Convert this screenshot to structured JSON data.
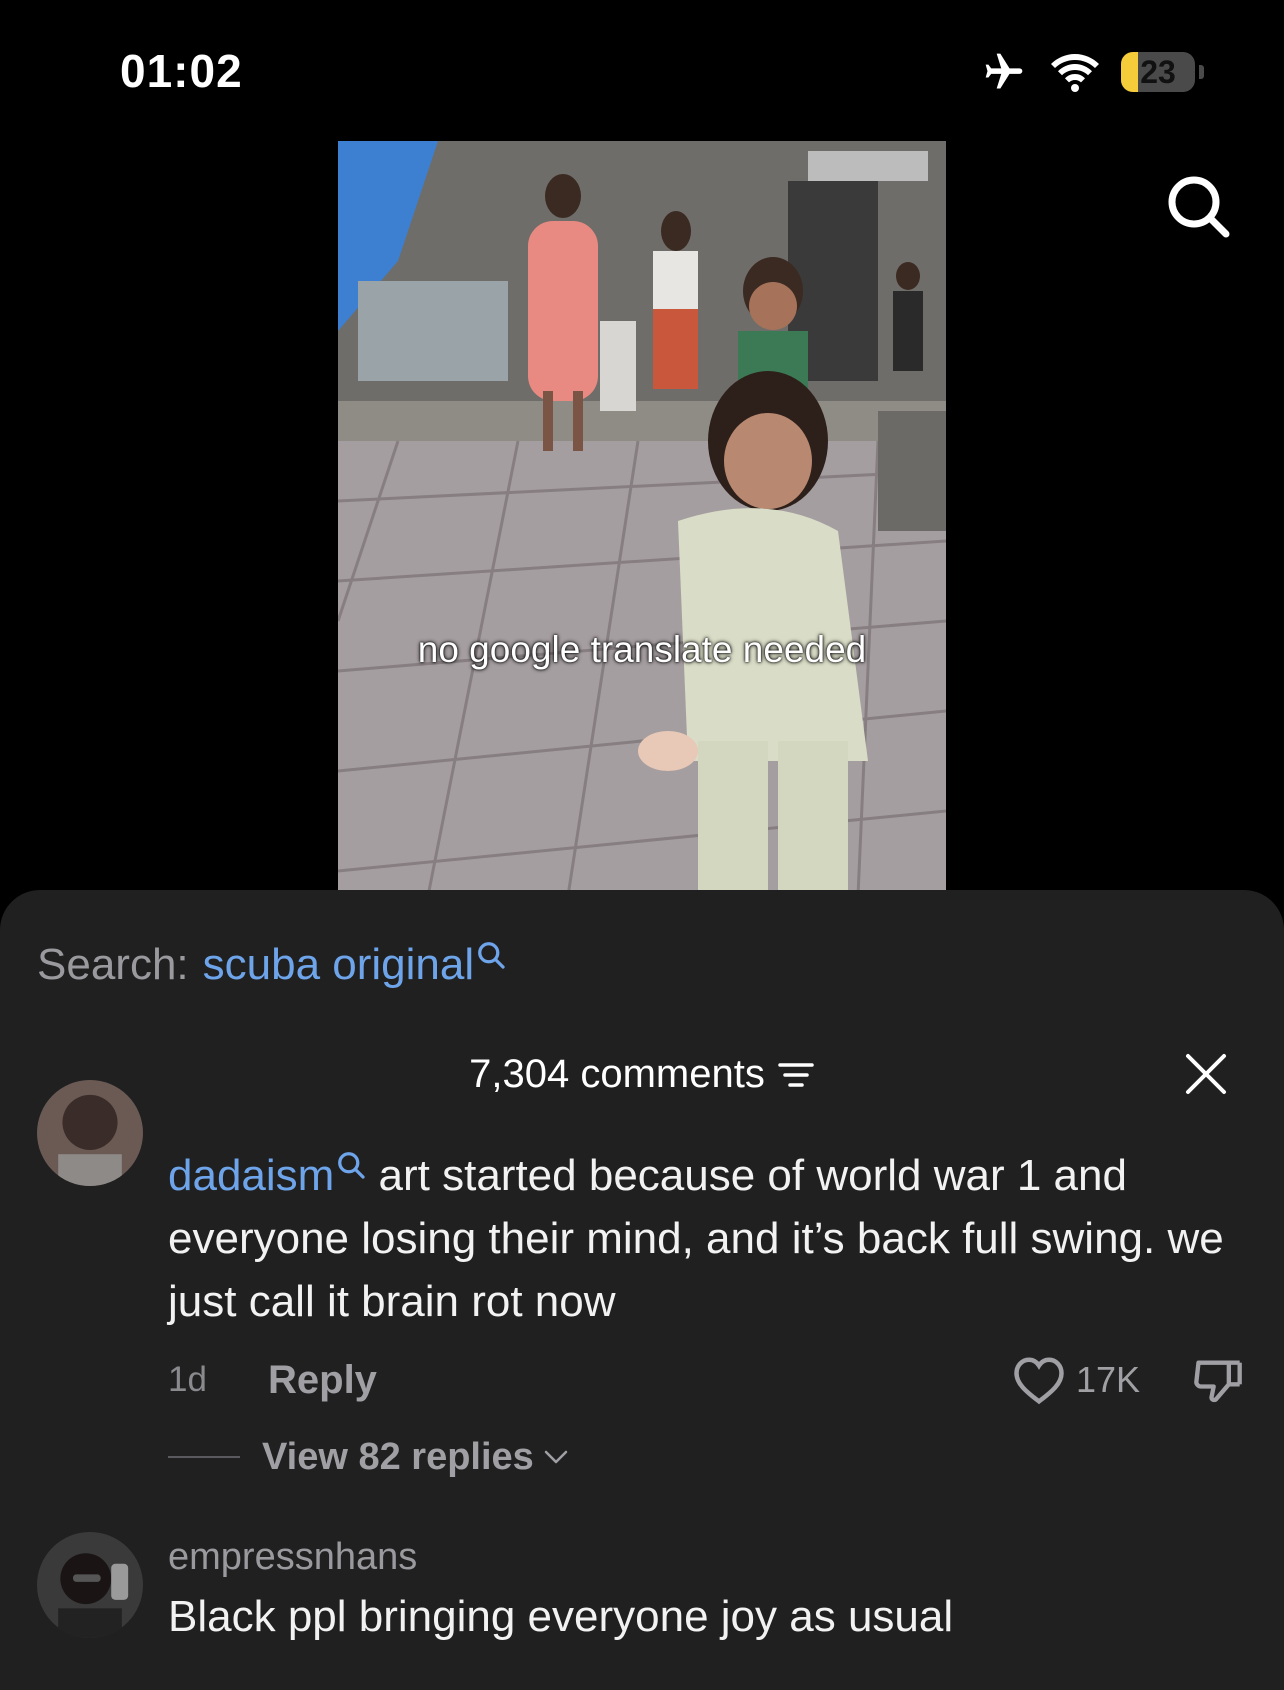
{
  "status_bar": {
    "time": "01:02",
    "battery_level": "23",
    "icons": [
      "airplane-icon",
      "wifi-icon",
      "battery-icon"
    ]
  },
  "video": {
    "caption": "no google translate needed"
  },
  "sheet": {
    "search_label": "Search:",
    "search_query": "scuba original",
    "comment_count": "7,304 comments"
  },
  "comments": [
    {
      "username": "dadaism",
      "text": " art started because of world war 1 and everyone losing their mind, and it’s back full swing. we just call it brain rot now",
      "time": "1d",
      "reply_label": "Reply",
      "likes": "17K",
      "view_replies": "View 82 replies"
    },
    {
      "username": "empressnhans",
      "text": "Black ppl bringing everyone joy as usual"
    }
  ],
  "colors": {
    "link_blue": "#6ea4ea",
    "sheet_bg": "#202021",
    "battery_yellow": "#f5cc3a"
  }
}
